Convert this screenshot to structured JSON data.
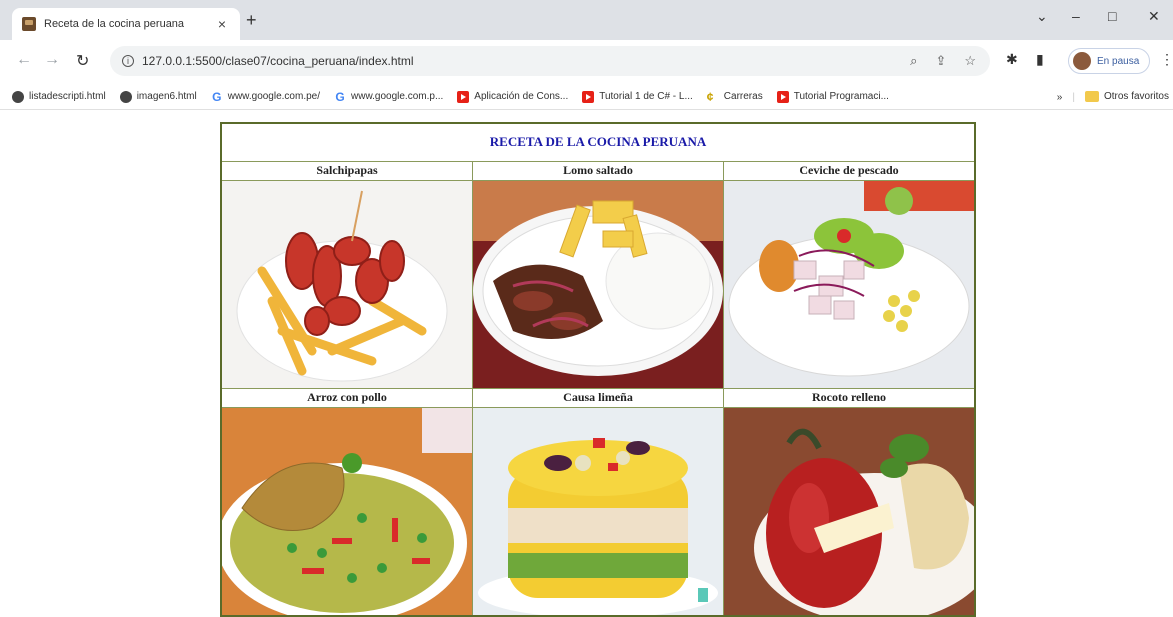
{
  "browser": {
    "tab_title": "Receta de la cocina peruana",
    "tab_close": "×",
    "new_tab": "+",
    "url": "127.0.0.1:5500/clase07/cocina_peruana/index.html",
    "profile_label": "En pausa",
    "window_controls": [
      "⌄",
      "–",
      "□",
      "✕"
    ]
  },
  "bookmarks": {
    "items": [
      {
        "icon": "globe-icon",
        "label": "listadescripti.html"
      },
      {
        "icon": "globe-icon",
        "label": "imagen6.html"
      },
      {
        "icon": "google-icon",
        "label": "www.google.com.pe/"
      },
      {
        "icon": "google-icon",
        "label": "www.google.com.p..."
      },
      {
        "icon": "youtube-icon",
        "label": "Aplicación de Cons..."
      },
      {
        "icon": "youtube-icon",
        "label": "Tutorial 1 de C# - L..."
      },
      {
        "icon": "carreras-icon",
        "label": "Carreras"
      },
      {
        "icon": "youtube-icon",
        "label": "Tutorial Programaci..."
      }
    ],
    "overflow": "»",
    "other_bookmarks": "Otros favoritos"
  },
  "page": {
    "caption": "RECETA DE LA COCINA PERUANA",
    "dishes": [
      {
        "name": "Salchipapas"
      },
      {
        "name": "Lomo saltado"
      },
      {
        "name": "Ceviche de pescado"
      },
      {
        "name": "Arroz con pollo"
      },
      {
        "name": "Causa limeña"
      },
      {
        "name": "Rocoto relleno"
      }
    ]
  },
  "colors": {
    "caption_text": "#1a1aa8",
    "table_border": "#5a6b2a"
  }
}
